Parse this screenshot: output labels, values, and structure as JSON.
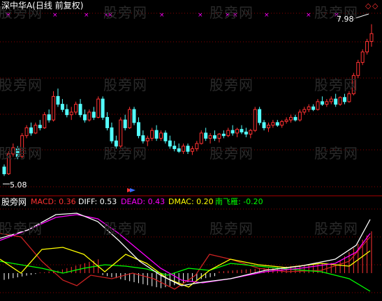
{
  "header": {
    "title": "深中华A(日线 前复权)"
  },
  "watermarks": [
    "股旁网",
    "股旁网",
    "股旁网",
    "股旁网",
    "股旁网",
    "股旁网",
    "股旁网",
    "股旁网",
    "股旁网",
    "股旁网",
    "股旁网",
    "股旁网"
  ],
  "price_labels": {
    "high": "7.98",
    "low": "5.08"
  },
  "indicator_bar": {
    "logo": "股旁网",
    "macd": "MACD: 0.36",
    "diff": "DIFF: 0.53",
    "dead": "DEAD: 0.43",
    "dmac": "DMAC: 0.20",
    "nfy": "南飞雁: -0.20"
  },
  "colors": {
    "up": "#ff3232",
    "down": "#54ffff",
    "grid": "#8b0000",
    "diff": "#ffffff",
    "dead": "#ff00ff",
    "dmac": "#ffff00",
    "nfy": "#00ff00",
    "macd_label": "#ff3232"
  },
  "chart_data": {
    "type": "candlestick",
    "price_range": [
      4.9,
      8.15
    ],
    "candles": [
      [
        5.25,
        5.3,
        5.08,
        5.12
      ],
      [
        5.12,
        5.55,
        5.1,
        5.5
      ],
      [
        5.5,
        5.7,
        5.45,
        5.62
      ],
      [
        5.6,
        5.65,
        5.4,
        5.45
      ],
      [
        5.45,
        5.9,
        5.42,
        5.85
      ],
      [
        5.85,
        6.05,
        5.8,
        6.0
      ],
      [
        6.0,
        6.1,
        5.85,
        5.9
      ],
      [
        5.9,
        6.1,
        5.88,
        6.05
      ],
      [
        6.05,
        6.15,
        5.95,
        6.0
      ],
      [
        6.0,
        6.3,
        5.98,
        6.25
      ],
      [
        6.25,
        6.35,
        6.1,
        6.15
      ],
      [
        6.15,
        6.7,
        6.12,
        6.6
      ],
      [
        6.6,
        6.75,
        6.4,
        6.45
      ],
      [
        6.45,
        6.55,
        6.3,
        6.35
      ],
      [
        6.35,
        6.45,
        6.2,
        6.25
      ],
      [
        6.25,
        6.4,
        6.15,
        6.3
      ],
      [
        6.3,
        6.5,
        6.25,
        6.45
      ],
      [
        6.45,
        6.55,
        6.2,
        6.25
      ],
      [
        6.25,
        6.35,
        6.1,
        6.15
      ],
      [
        6.15,
        6.35,
        6.12,
        6.3
      ],
      [
        6.3,
        6.4,
        6.15,
        6.2
      ],
      [
        6.2,
        6.6,
        6.18,
        6.55
      ],
      [
        6.55,
        6.6,
        6.15,
        6.2
      ],
      [
        6.2,
        6.3,
        5.95,
        6.0
      ],
      [
        6.0,
        6.1,
        5.7,
        5.75
      ],
      [
        5.75,
        5.85,
        5.6,
        5.65
      ],
      [
        5.65,
        6.2,
        5.62,
        6.15
      ],
      [
        6.15,
        6.25,
        5.95,
        6.0
      ],
      [
        6.0,
        6.4,
        5.98,
        6.35
      ],
      [
        6.35,
        6.4,
        6.05,
        6.1
      ],
      [
        6.1,
        6.2,
        5.8,
        5.85
      ],
      [
        5.85,
        5.95,
        5.7,
        5.75
      ],
      [
        5.75,
        5.85,
        5.65,
        5.8
      ],
      [
        5.8,
        6.0,
        5.75,
        5.95
      ],
      [
        5.95,
        6.05,
        5.75,
        5.8
      ],
      [
        5.8,
        5.95,
        5.75,
        5.9
      ],
      [
        5.9,
        5.95,
        5.7,
        5.75
      ],
      [
        5.75,
        5.85,
        5.6,
        5.65
      ],
      [
        5.65,
        5.75,
        5.55,
        5.6
      ],
      [
        5.6,
        5.7,
        5.52,
        5.55
      ],
      [
        5.55,
        5.7,
        5.5,
        5.65
      ],
      [
        5.65,
        5.7,
        5.5,
        5.55
      ],
      [
        5.55,
        5.65,
        5.48,
        5.6
      ],
      [
        5.6,
        5.75,
        5.55,
        5.7
      ],
      [
        5.7,
        5.95,
        5.68,
        5.9
      ],
      [
        5.9,
        6.0,
        5.75,
        5.8
      ],
      [
        5.8,
        5.9,
        5.7,
        5.85
      ],
      [
        5.85,
        5.95,
        5.75,
        5.8
      ],
      [
        5.8,
        5.9,
        5.72,
        5.88
      ],
      [
        5.88,
        5.95,
        5.8,
        5.85
      ],
      [
        5.85,
        6.0,
        5.82,
        5.95
      ],
      [
        5.95,
        6.05,
        5.85,
        5.9
      ],
      [
        5.9,
        6.0,
        5.82,
        5.97
      ],
      [
        5.97,
        6.05,
        5.88,
        5.92
      ],
      [
        5.92,
        6.0,
        5.82,
        5.88
      ],
      [
        5.88,
        5.98,
        5.8,
        5.95
      ],
      [
        5.95,
        6.4,
        5.92,
        6.35
      ],
      [
        6.35,
        6.4,
        6.05,
        6.1
      ],
      [
        6.1,
        6.15,
        5.95,
        6.0
      ],
      [
        6.0,
        6.1,
        5.92,
        6.05
      ],
      [
        6.05,
        6.15,
        6.0,
        6.1
      ],
      [
        6.1,
        6.15,
        6.02,
        6.05
      ],
      [
        6.05,
        6.15,
        6.0,
        6.12
      ],
      [
        6.12,
        6.2,
        6.08,
        6.15
      ],
      [
        6.15,
        6.25,
        6.1,
        6.2
      ],
      [
        6.2,
        6.25,
        6.12,
        6.15
      ],
      [
        6.15,
        6.35,
        6.12,
        6.3
      ],
      [
        6.3,
        6.4,
        6.25,
        6.35
      ],
      [
        6.35,
        6.45,
        6.3,
        6.4
      ],
      [
        6.4,
        6.45,
        6.32,
        6.35
      ],
      [
        6.35,
        6.55,
        6.33,
        6.5
      ],
      [
        6.5,
        6.6,
        6.42,
        6.45
      ],
      [
        6.45,
        6.55,
        6.4,
        6.5
      ],
      [
        6.5,
        6.6,
        6.45,
        6.55
      ],
      [
        6.55,
        6.65,
        6.4,
        6.45
      ],
      [
        6.45,
        6.6,
        6.42,
        6.58
      ],
      [
        6.58,
        6.65,
        6.45,
        6.5
      ],
      [
        6.5,
        6.7,
        6.48,
        6.65
      ],
      [
        6.65,
        7.05,
        6.62,
        7.0
      ],
      [
        7.0,
        7.3,
        6.95,
        7.25
      ],
      [
        7.25,
        7.5,
        7.2,
        7.45
      ],
      [
        7.45,
        7.7,
        7.4,
        7.65
      ],
      [
        7.65,
        7.98,
        7.55,
        7.8
      ]
    ],
    "markers": "purple x marks along top of chart",
    "indicator": {
      "DIFF": 0.53,
      "DEAD": 0.43,
      "DMAC": 0.2,
      "MACD": 0.36,
      "南飞雁": -0.2
    }
  }
}
